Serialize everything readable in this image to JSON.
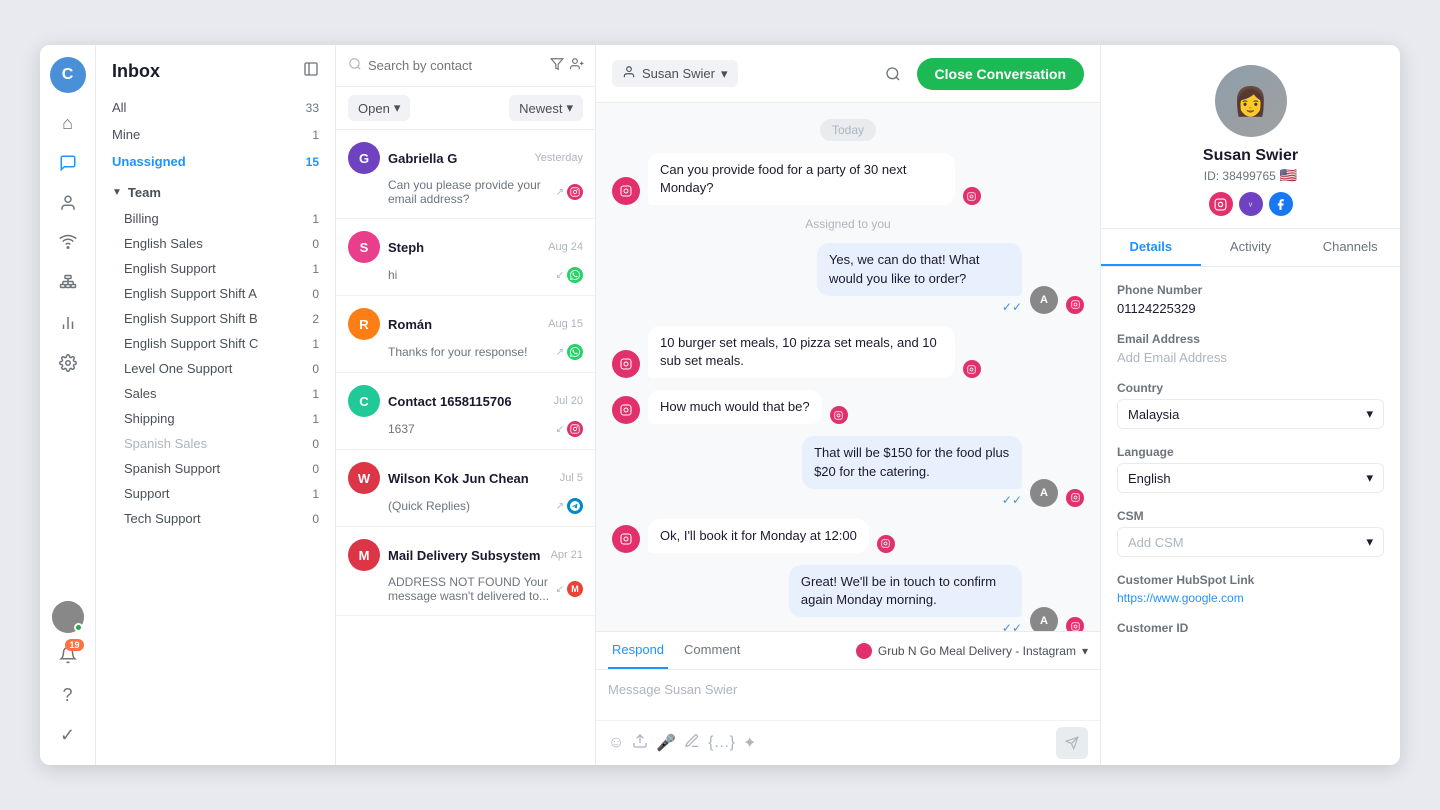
{
  "app": {
    "title": "Inbox"
  },
  "leftNav": {
    "avatar": "C",
    "avatarColor": "#4a90d9",
    "icons": [
      {
        "name": "home-icon",
        "symbol": "⌂",
        "active": false
      },
      {
        "name": "chat-icon",
        "symbol": "💬",
        "active": true
      },
      {
        "name": "contacts-icon",
        "symbol": "👤",
        "active": false
      },
      {
        "name": "signal-icon",
        "symbol": "📡",
        "active": false
      },
      {
        "name": "hierarchy-icon",
        "symbol": "⋮",
        "active": false
      },
      {
        "name": "chart-icon",
        "symbol": "📊",
        "active": false
      },
      {
        "name": "settings-icon",
        "symbol": "⚙",
        "active": false
      }
    ],
    "bottomIcons": [
      {
        "name": "notifications-icon",
        "symbol": "🔔",
        "badge": "19"
      },
      {
        "name": "help-icon",
        "symbol": "?"
      },
      {
        "name": "check-icon",
        "symbol": "✓"
      }
    ]
  },
  "sidebar": {
    "title": "Inbox",
    "navItems": [
      {
        "label": "All",
        "count": 33,
        "active": false
      },
      {
        "label": "Mine",
        "count": 1,
        "active": false
      },
      {
        "label": "Unassigned",
        "count": 15,
        "active": true
      }
    ],
    "teamSection": {
      "label": "Team",
      "items": [
        {
          "label": "Billing",
          "count": 1,
          "disabled": false
        },
        {
          "label": "English Sales",
          "count": 0,
          "disabled": false
        },
        {
          "label": "English Support",
          "count": 1,
          "disabled": false
        },
        {
          "label": "English Support Shift A",
          "count": 0,
          "disabled": false
        },
        {
          "label": "English Support Shift B",
          "count": 2,
          "disabled": false
        },
        {
          "label": "English Support Shift C",
          "count": 1,
          "disabled": false
        },
        {
          "label": "Level One Support",
          "count": 0,
          "disabled": false
        },
        {
          "label": "Sales",
          "count": 1,
          "disabled": false
        },
        {
          "label": "Shipping",
          "count": 1,
          "disabled": false
        },
        {
          "label": "Spanish Sales",
          "count": 0,
          "disabled": true
        },
        {
          "label": "Spanish Support",
          "count": 0,
          "disabled": false
        },
        {
          "label": "Support",
          "count": 1,
          "disabled": false
        },
        {
          "label": "Tech Support",
          "count": 0,
          "disabled": false
        }
      ]
    }
  },
  "conversationList": {
    "searchPlaceholder": "Search by contact",
    "filterLabel": "Open",
    "sortLabel": "Newest",
    "conversations": [
      {
        "id": 1,
        "name": "Gabriella G",
        "date": "Yesterday",
        "preview": "Can you please provide your email address?",
        "avatarColor": "#6f42c1",
        "initials": "G",
        "channelColor": "#e1306c",
        "channelSymbol": "📷",
        "channelType": "instagram",
        "hasArrow": true
      },
      {
        "id": 2,
        "name": "Steph",
        "date": "Aug 24",
        "preview": "hi",
        "avatarColor": "#e83e8c",
        "initials": "S",
        "channelColor": "#00b341",
        "channelSymbol": "●",
        "channelType": "whatsapp",
        "hasArrow": false
      },
      {
        "id": 3,
        "name": "Román",
        "date": "Aug 15",
        "preview": "Thanks for your response!",
        "avatarColor": "#fd7e14",
        "initials": "R",
        "channelColor": "#00b341",
        "channelSymbol": "●",
        "channelType": "whatsapp",
        "hasArrow": true
      },
      {
        "id": 4,
        "name": "Contact 1658115706",
        "date": "Jul 20",
        "preview": "1637",
        "avatarColor": "#20c997",
        "initials": "C",
        "channelColor": "#e1306c",
        "channelSymbol": "📷",
        "channelType": "instagram",
        "hasArrow": false
      },
      {
        "id": 5,
        "name": "Wilson Kok Jun Chean",
        "date": "Jul 5",
        "preview": "(Quick Replies)",
        "avatarColor": "#dc3545",
        "initials": "W",
        "channelColor": "#0088cc",
        "channelSymbol": "✈",
        "channelType": "telegram",
        "hasArrow": true
      },
      {
        "id": 6,
        "name": "Mail Delivery Subsystem",
        "date": "Apr 21",
        "preview": "ADDRESS NOT FOUND Your message wasn't delivered to...",
        "avatarColor": "#dc3545",
        "initials": "M",
        "channelColor": "#ea4335",
        "channelSymbol": "M",
        "channelType": "gmail",
        "hasArrow": false
      }
    ]
  },
  "chat": {
    "contactName": "Susan Swier",
    "closeButton": "Close Conversation",
    "messages": [
      {
        "type": "date-divider",
        "text": "Today"
      },
      {
        "type": "incoming",
        "text": "Can you provide food for a party of 30 next Monday?",
        "avatarColor": "#e1306c",
        "channelColor": "#e1306c"
      },
      {
        "type": "system",
        "text": "Assigned to you"
      },
      {
        "type": "outgoing",
        "text": "Yes, we can do that! What would you like to order?",
        "avatarColor": "#888",
        "channelColor": "#e1306c",
        "read": true
      },
      {
        "type": "incoming",
        "text": "10 burger set meals, 10 pizza set meals, and 10 sub set meals.",
        "avatarColor": "#e1306c",
        "channelColor": "#e1306c"
      },
      {
        "type": "incoming",
        "text": "How much would that be?",
        "avatarColor": "#e1306c",
        "channelColor": "#e1306c"
      },
      {
        "type": "outgoing",
        "text": "That will be $150 for the food plus $20 for the catering.",
        "avatarColor": "#888",
        "channelColor": "#e1306c",
        "read": true
      },
      {
        "type": "incoming",
        "text": "Ok, I'll book it for Monday at 12:00",
        "avatarColor": "#e1306c",
        "channelColor": "#e1306c"
      },
      {
        "type": "outgoing",
        "text": "Great! We'll be in touch to confirm again Monday morning.",
        "avatarColor": "#888",
        "channelColor": "#e1306c",
        "read": true
      }
    ],
    "replyTabs": [
      "Respond",
      "Comment"
    ],
    "activeReplyTab": "Respond",
    "replyPlaceholder": "Message Susan Swier",
    "replyChannel": "Grub N Go Meal Delivery - Instagram"
  },
  "rightPanel": {
    "contact": {
      "name": "Susan Swier",
      "id": "ID: 38499765",
      "flag": "🇺🇸"
    },
    "tabs": [
      "Details",
      "Activity",
      "Channels"
    ],
    "activeTab": "Details",
    "fields": [
      {
        "label": "Phone Number",
        "value": "01124225329",
        "type": "text"
      },
      {
        "label": "Email Address",
        "value": "",
        "placeholder": "Add Email Address",
        "type": "text"
      },
      {
        "label": "Country",
        "value": "Malaysia",
        "type": "select"
      },
      {
        "label": "Language",
        "value": "English",
        "type": "select"
      },
      {
        "label": "CSM",
        "value": "",
        "placeholder": "Add CSM",
        "type": "select"
      },
      {
        "label": "Customer HubSpot Link",
        "value": "https://www.google.com",
        "type": "text"
      },
      {
        "label": "Customer ID",
        "value": "",
        "placeholder": "",
        "type": "text"
      }
    ]
  }
}
